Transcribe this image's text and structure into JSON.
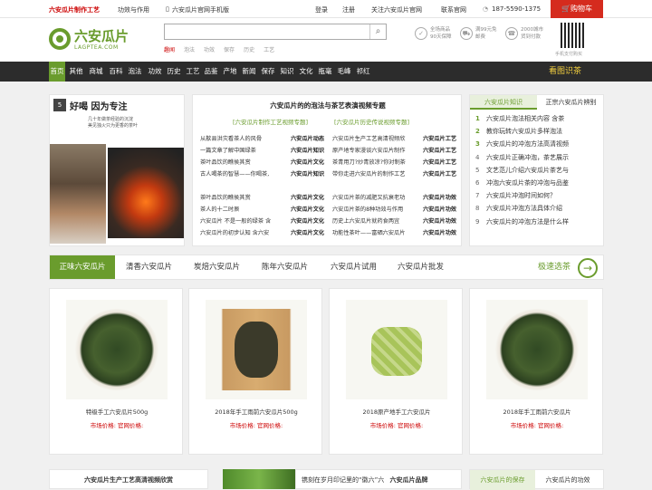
{
  "topbar": {
    "brand": "六安瓜片制作工艺",
    "links": [
      "功效与作用",
      "六安瓜片官网手机版"
    ],
    "right": [
      "登录",
      "注册",
      "关注六安瓜片官网",
      "联系官网"
    ],
    "phone": "187-5590-1375",
    "cart": "购物车"
  },
  "header": {
    "logo_cn": "六安瓜片",
    "logo_en": "LAGPTEA.COM",
    "search_placeholder": "",
    "hot": [
      "趣闻",
      "泡法",
      "功效",
      "保存",
      "历史",
      "工艺"
    ],
    "services": [
      {
        "icon": "shield-icon",
        "l1": "全场商品",
        "l2": "90天保障"
      },
      {
        "icon": "truck-icon",
        "l1": "满99元免",
        "l2": "邮费"
      },
      {
        "icon": "phone-icon",
        "l1": "2000城市",
        "l2": "货到付款"
      }
    ],
    "qr_caption": "手机支付购买"
  },
  "nav": {
    "items": [
      "首页",
      "其他",
      "商城",
      "百科",
      "泡法",
      "功效",
      "历史",
      "工艺",
      "品鉴",
      "产地",
      "新闻",
      "保存",
      "知识",
      "文化",
      "瓶毫",
      "毛峰",
      "祁红"
    ],
    "right": "看图识茶"
  },
  "banner": {
    "badge": "5",
    "title": "好喝 因为专注",
    "lines": [
      "几十年做茶经验的沉淀",
      "美见独火只为更香的茶叶"
    ]
  },
  "center": {
    "title": "六安瓜片的的泡法与茶艺表演视频专题",
    "sub1": "[六安瓜片制作工艺视频专题]",
    "sub2": "[六安瓜片历史传说视频专题]",
    "left": [
      "从歙县洪灾看茶人的风骨",
      "一篇文章了解中国绿茶",
      "茶叶品饮的瞧侯其赏",
      "古人喝茶的智慧——你喝茶,",
      "",
      "茶叶品饮的瞧侯其赏",
      "茶人的十二时辰",
      "六安瓜片 不是一般的绿茶 含",
      "六安瓜片的初步认知 含六安"
    ],
    "right": [
      {
        "tag": "六安瓜片动态",
        "text": "六安瓜片生产工艺高清视频欣",
        "tail": "六安瓜片工艺"
      },
      {
        "tag": "六安瓜片知识",
        "text": "原产地专家漫谈六安瓜片制作",
        "tail": "六安瓜片工艺"
      },
      {
        "tag": "六安瓜片文化",
        "text": "茶青用刀?炒青放凉?你对制茶",
        "tail": "六安瓜片工艺"
      },
      {
        "tag": "六安瓜片知识",
        "text": "带你走进六安瓜片的制作工艺",
        "tail": "六安瓜片工艺"
      },
      {
        "tag": "",
        "text": "",
        "tail": ""
      },
      {
        "tag": "六安瓜片文化",
        "text": "六安瓜片茶的减肥又抗衰老功",
        "tail": "六安瓜片功效"
      },
      {
        "tag": "六安瓜片文化",
        "text": "六安瓜片茶的8种功效与作用",
        "tail": "六安瓜片功效"
      },
      {
        "tag": "六安瓜片文化",
        "text": "历史上六安瓜片就药食两宜",
        "tail": "六安瓜片功效"
      },
      {
        "tag": "六安瓜片文化",
        "text": "功能性茶叶——富硒六安瓜片",
        "tail": "六安瓜片功效"
      }
    ]
  },
  "rightTabs": {
    "tabs": [
      "六安瓜片知识",
      "正宗六安瓜片辨别"
    ],
    "items": [
      "六安瓜片泡法相关内容 含茶",
      "教你玩转六安瓜片多样泡法",
      "六安瓜片的冲泡方法高清视频",
      "六安瓜片正确冲泡，茶艺展示",
      "文艺范儿介绍六安瓜片茶艺与",
      "冲泡六安瓜片茶的冲泡与品鉴",
      "六安瓜片冲泡时间如何？",
      "六安瓜片冲泡方法具体介绍",
      "六安瓜片的冲泡方法是什么样"
    ]
  },
  "categories": {
    "items": [
      "正味六安瓜片",
      "清香六安瓜片",
      "炭焙六安瓜片",
      "陈年六安瓜片",
      "六安瓜片试用",
      "六安瓜片批发"
    ],
    "more": "极速选茶",
    "arrow": "→"
  },
  "products": [
    {
      "name": "特级手工六安瓜片500g",
      "price": "市场价格: 官网价格:"
    },
    {
      "name": "2018年手工雨前六安瓜片500g",
      "price": "市场价格: 官网价格:"
    },
    {
      "name": "2018原产地手工六安瓜片",
      "price": "市场价格: 官网价格:"
    },
    {
      "name": "2018年手工雨前六安瓜片",
      "price": "市场价格: 官网价格:"
    }
  ],
  "bottom": {
    "left": "六安瓜片生产工艺高清视频欣赏",
    "mid": "镌刻在岁月印记里的“徽六”六",
    "midBold": "六安瓜片品牌",
    "tabs": [
      "六安瓜片的保存",
      "六安瓜片的功效"
    ]
  },
  "colors": {
    "brand": "#6a9c2d",
    "accent": "#d52b1e",
    "nav": "#2c2c2c"
  }
}
